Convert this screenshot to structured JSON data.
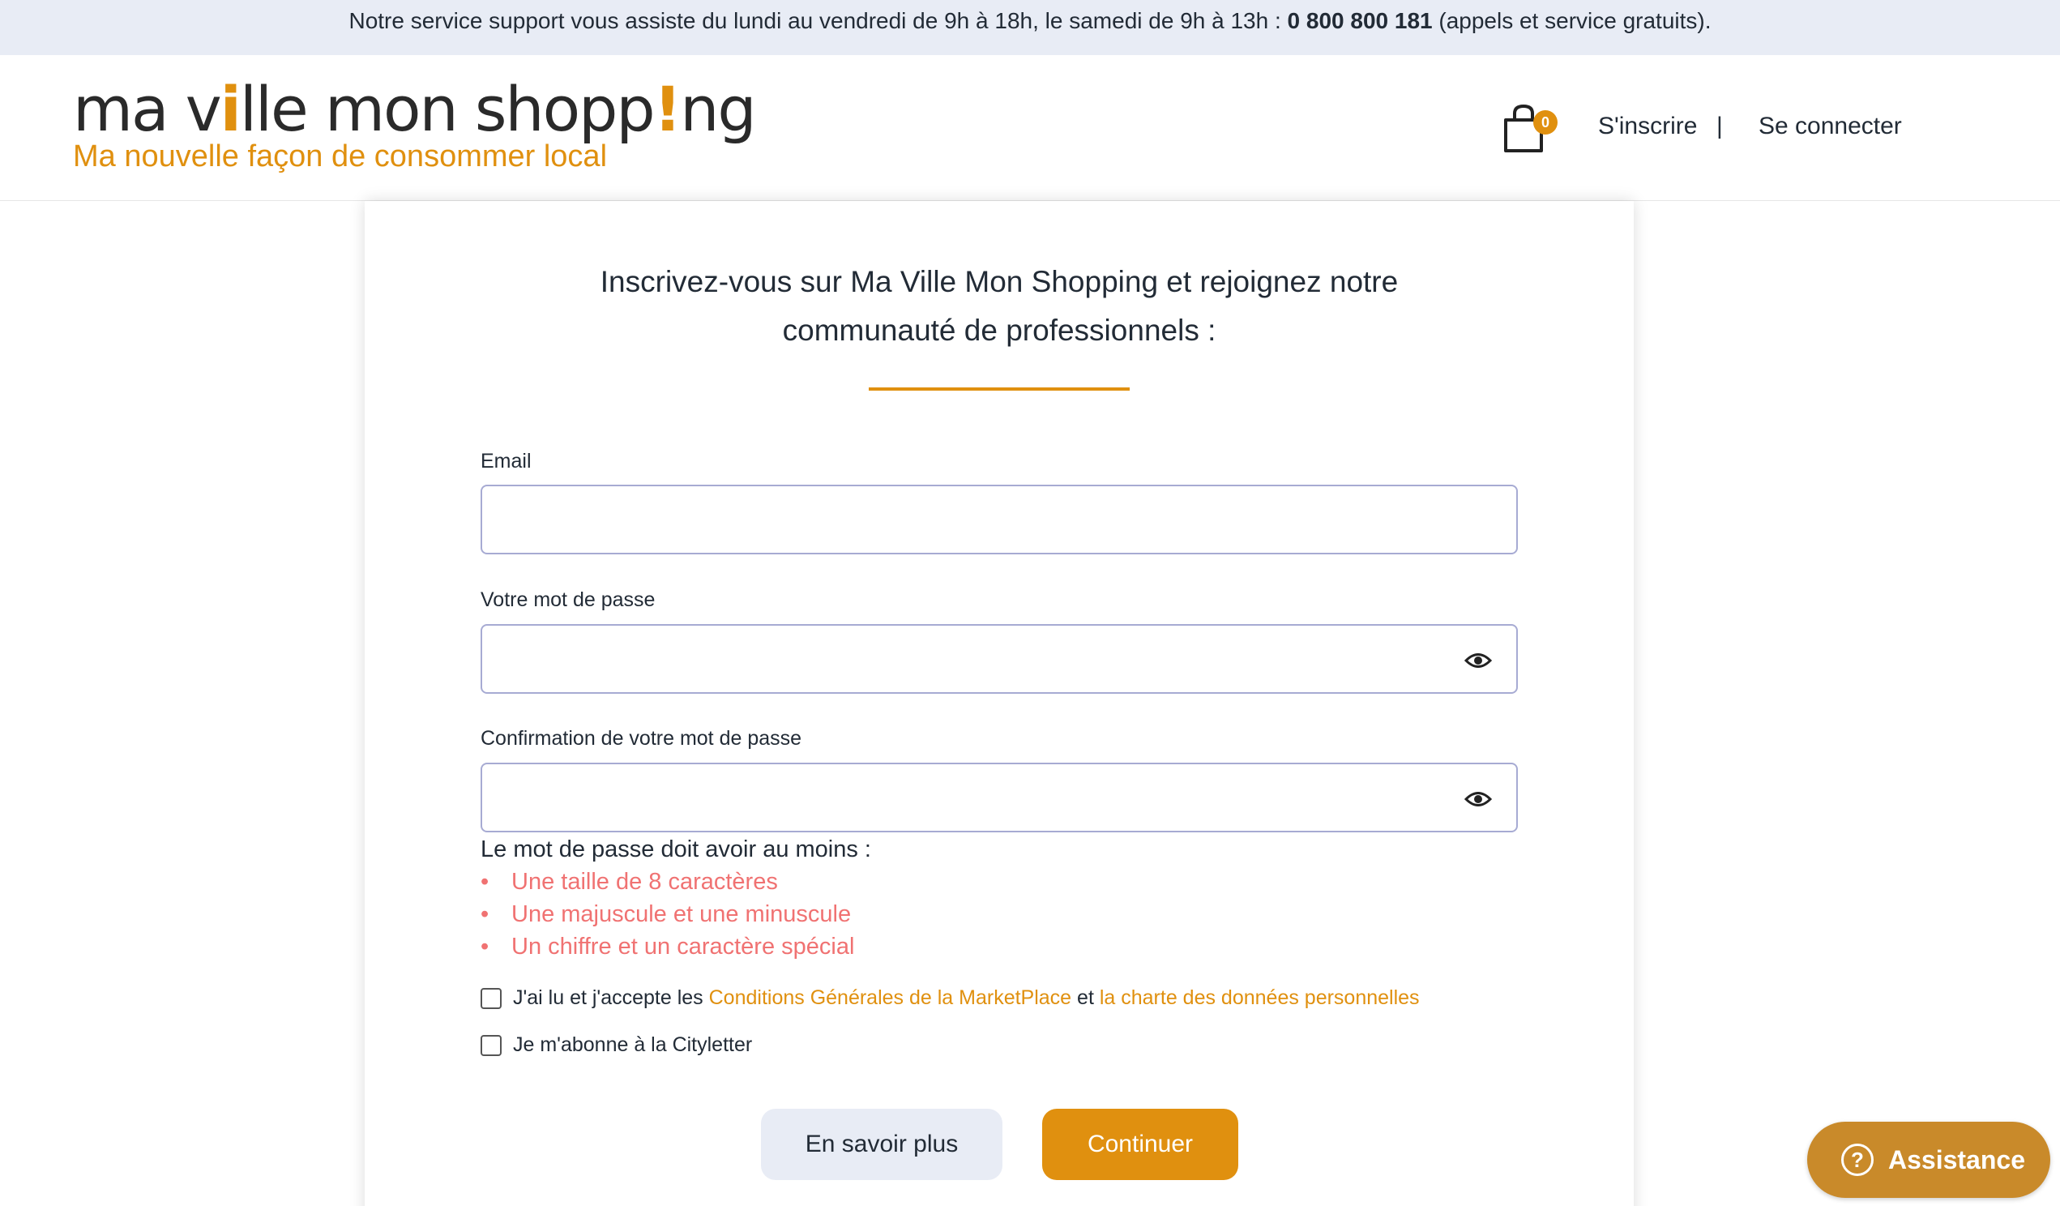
{
  "topbar": {
    "text_before": "Notre service support vous assiste du lundi au vendredi de 9h à 18h, le samedi de 9h à 13h : ",
    "phone": "0 800 800 181",
    "text_after": " (appels et service gratuits)."
  },
  "header": {
    "logo_part1": "ma v",
    "logo_i": "i",
    "logo_part2": "lle mon shopp",
    "logo_exclaim": "!",
    "logo_part3": "ng",
    "tagline": "Ma nouvelle façon de consommer local",
    "cart_count": "0",
    "signup_label": "S'inscrire",
    "separator": "|",
    "login_label": "Se connecter"
  },
  "form": {
    "title_line1": "Inscrivez-vous sur Ma Ville Mon Shopping et rejoignez notre",
    "title_line2": "communauté de professionnels :",
    "email_label": "Email",
    "email_value": "",
    "password_label": "Votre mot de passe",
    "password_value": "",
    "confirm_label": "Confirmation de votre mot de passe",
    "confirm_value": "",
    "rules_heading": "Le mot de passe doit avoir au moins :",
    "rules": [
      "Une taille de 8 caractères",
      "Une majuscule et une minuscule",
      "Un chiffre et un caractère spécial"
    ],
    "terms_prefix": "J'ai lu et j'accepte les ",
    "terms_link": "Conditions Générales de la MarketPlace",
    "terms_mid": " et ",
    "privacy_link": "la charte des données personnelles",
    "newsletter_label": "Je m'abonne à la Cityletter",
    "learn_more_label": "En savoir plus",
    "continue_label": "Continuer"
  },
  "assistance": {
    "icon": "?",
    "label": "Assistance"
  },
  "colors": {
    "accent": "#e0900f",
    "topbar_bg": "#e8ecf5",
    "rule_red": "#f07272",
    "field_border": "#a7abd3"
  },
  "icons": [
    "shopping-bag-icon",
    "eye-icon",
    "question-icon"
  ]
}
